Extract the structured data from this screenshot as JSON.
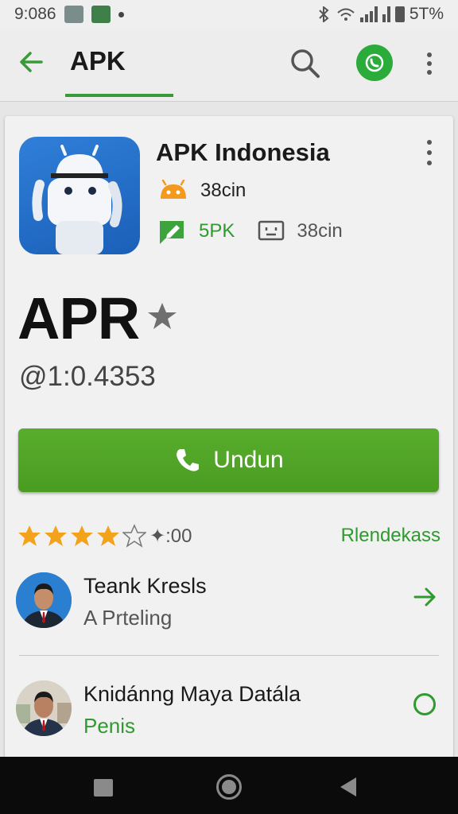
{
  "status_bar": {
    "time": "9:086",
    "battery": "5T%",
    "icons": [
      "photo-icon",
      "messages-icon",
      "notification-dot",
      "bluetooth-icon",
      "wifi-icon",
      "signal-icon",
      "battery-icon"
    ]
  },
  "app_bar": {
    "title": "APK",
    "icons": [
      "back-arrow-icon",
      "search-icon",
      "whatsapp-icon",
      "more-vert-icon"
    ],
    "accent": "#3a9a3a"
  },
  "app_card": {
    "name": "APK Indonesia",
    "meta_downloads": "38cin",
    "meta_size": "5PK",
    "meta_device": "38cin",
    "big_title": "APR",
    "version": "@1:0.4353",
    "install_label": "Undun",
    "install_color": "#52a628",
    "rating": {
      "stars": 4,
      "max": 5,
      "value": "✦:00"
    },
    "recommend_label": "Rlendekass"
  },
  "list": [
    {
      "name": "Teank Kresls",
      "subtitle": "A Prteling",
      "action": "arrow-right-icon"
    },
    {
      "name": "Knidánng Maya Datála",
      "subtitle": "Penis",
      "action": "radio-circle-icon"
    }
  ],
  "nav_bar": {
    "icons": [
      "recent-apps-icon",
      "home-icon",
      "nav-back-icon"
    ]
  }
}
